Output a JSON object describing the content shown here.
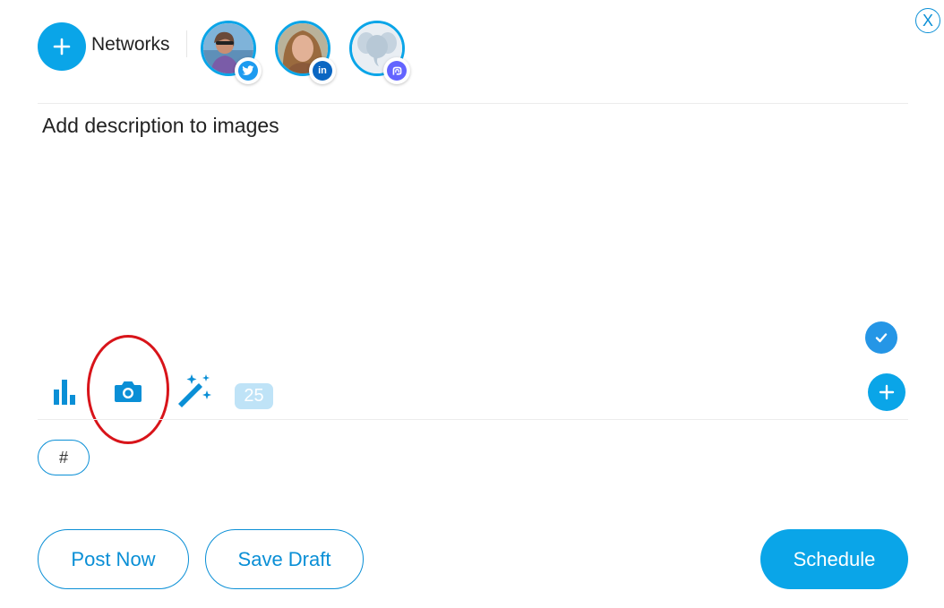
{
  "close": {
    "label": "X"
  },
  "networks": {
    "add_label": "+",
    "label": "Networks",
    "accounts": [
      {
        "network": "Twitter",
        "icon": "twitter-icon",
        "color": "#1d9bf0"
      },
      {
        "network": "LinkedIn",
        "icon": "linkedin-icon",
        "color": "#0a66c2"
      },
      {
        "network": "Mastodon",
        "icon": "mastodon-icon",
        "color": "#6364ff"
      }
    ]
  },
  "composer": {
    "description_text": "Add description to images"
  },
  "toolbar": {
    "stats_icon": "bar-chart-icon",
    "camera_icon": "camera-icon",
    "magic_icon": "magic-wand-icon",
    "char_count": "25"
  },
  "hashtag": {
    "label": "#"
  },
  "actions": {
    "post_now": "Post Now",
    "save_draft": "Save Draft",
    "schedule": "Schedule"
  },
  "colors": {
    "accent": "#0aa5e8",
    "accent_dark": "#0a8fd6",
    "highlight": "#d8141a"
  }
}
